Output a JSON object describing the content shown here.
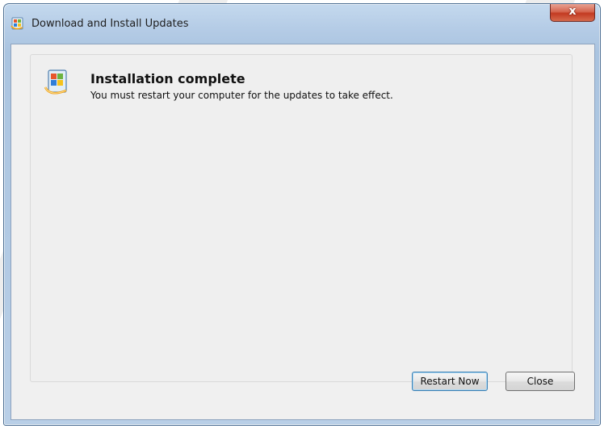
{
  "window": {
    "title": "Download and Install Updates",
    "close_glyph": "x",
    "app_icon": "windows-update-icon"
  },
  "content": {
    "status_icon": "windows-update-icon",
    "headline": "Installation complete",
    "message": "You must restart your computer for the updates to take effect."
  },
  "buttons": {
    "restart_label": "Restart Now",
    "close_label": "Close"
  },
  "colors": {
    "titlebar": "#b5cce6",
    "client_background": "#f0f0f0",
    "close_button": "#c33a22",
    "default_button_border": "#3c7fb1"
  }
}
